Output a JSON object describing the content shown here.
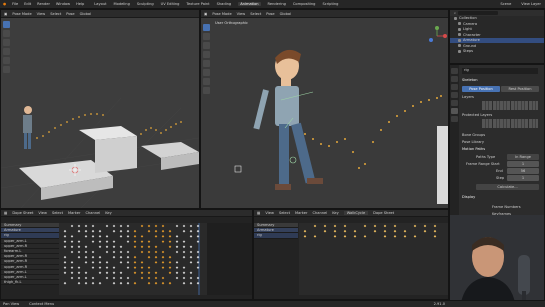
{
  "menu": {
    "items": [
      "File",
      "Edit",
      "Render",
      "Window",
      "Help"
    ]
  },
  "workspaces": {
    "items": [
      "Layout",
      "Modeling",
      "Sculpting",
      "UV Editing",
      "Texture Paint",
      "Shading",
      "Animation",
      "Rendering",
      "Compositing",
      "Scripting"
    ],
    "active_index": 6
  },
  "topbar_right": {
    "scene_label": "Scene",
    "view_layer_label": "View Layer"
  },
  "viewport_left": {
    "mode": "Pose Mode",
    "menus": [
      "View",
      "Select",
      "Pose"
    ],
    "pivot": "Global"
  },
  "viewport_right": {
    "mode": "Pose Mode",
    "menus": [
      "View",
      "Select",
      "Pose"
    ],
    "pivot": "Global",
    "overlay_title": "User Orthographic"
  },
  "outliner": {
    "search_placeholder": "",
    "rows": [
      "Collection",
      "Camera",
      "Light",
      "Character",
      "Armature",
      "Ground",
      "Steps"
    ]
  },
  "properties": {
    "object_name": "rig",
    "section_skeleton": "Skeleton",
    "pose_position": "Pose Position",
    "rest_position": "Rest Position",
    "layers_label": "Layers",
    "protected_layers_label": "Protected Layers",
    "bone_groups": "Bone Groups",
    "pose_library": "Pose Library",
    "motion_paths": "Motion Paths",
    "paths_type_label": "Paths Type",
    "paths_type_value": "In Range",
    "frame_range_label": "Frame Range Start",
    "frame_range_value": "1",
    "end_label": "End",
    "end_value": "56",
    "step_label": "Step",
    "step_value": "1",
    "calc_button": "Calculate...",
    "display_label": "Display",
    "frame_numbers": "Frame Numbers",
    "keyframes": "Keyframes",
    "keyframe_numbers": "+ Non-Grouped Keyframes",
    "lines": "Keyframe Numbers"
  },
  "dopesheet": {
    "mode": "Dope Sheet",
    "menus": [
      "View",
      "Select",
      "Marker",
      "Channel",
      "Key"
    ],
    "channels": [
      "Summary",
      "Armature",
      "rig",
      "upper_arm.L",
      "upper_arm.R",
      "forearm.L",
      "upper_arm.R",
      "upper_arm.R",
      "upper_arm.R",
      "upper_arm.L",
      "upper_arm.L",
      "thigh_fk.L"
    ]
  },
  "timeline_right": {
    "mode": "Dope Sheet",
    "menus": [
      "View",
      "Select",
      "Marker",
      "Channel",
      "Key"
    ],
    "action_name": "WalkCycle",
    "channels": [
      "Summary",
      "Armature",
      "rig"
    ]
  },
  "status": {
    "left_items": [
      "Pan View",
      "Context Menu"
    ],
    "version": "2.91.0"
  },
  "colors": {
    "accent": "#4772b3",
    "keyframe": "#e39a2b",
    "path_dot": "#e3a63a",
    "selected_key": "#f0c060"
  }
}
